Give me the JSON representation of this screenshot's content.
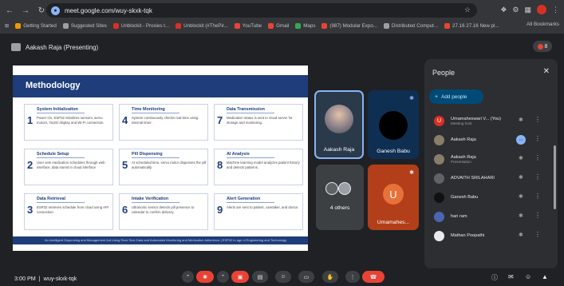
{
  "browser": {
    "url": "meet.google.com/wuy-skxk-tqk",
    "bookmarks": [
      {
        "label": "Getting Started",
        "color": "#f29900"
      },
      {
        "label": "Suggested Sites",
        "color": "#9aa0a6"
      },
      {
        "label": "Unblockit - Proxies t...",
        "color": "#d93025"
      },
      {
        "label": "Unblockit (#ThePir...",
        "color": "#d93025"
      },
      {
        "label": "YouTube",
        "color": "#ea4335"
      },
      {
        "label": "Gmail",
        "color": "#ea4335"
      },
      {
        "label": "Maps",
        "color": "#34a853"
      },
      {
        "label": "(987) Modular Expo...",
        "color": "#ea4335"
      },
      {
        "label": "Distributed Comput...",
        "color": "#9aa0a6"
      },
      {
        "label": "27.16 27.16 New pl...",
        "color": "#ea4335"
      }
    ],
    "all_bookmarks": "All Bookmarks"
  },
  "meet": {
    "presenter": "Aakash Raja (Presenting)",
    "clock": "3:00 PM",
    "meeting_code": "wuy-skxk-tqk",
    "badge_count": "8"
  },
  "slide": {
    "title": "Methodology",
    "footer": "An Intelligent Dispensing and Management Aid Using Real-Time Data and Automated Monitoring and Medication Adherence | ESP32 in age of Engineering and Technology",
    "cards": [
      {
        "num": "1",
        "title": "System Initialization",
        "text": "Power On, ESP32 initializes sensors, servo motors, OLED display and Wi-Fi connection."
      },
      {
        "num": "2",
        "title": "Schedule Setup",
        "text": "User sets medication schedules through web interface, data stored in cloud interface"
      },
      {
        "num": "3",
        "title": "Data Retrieval",
        "text": "ESP32 retrieves schedule from cloud using API connection"
      },
      {
        "num": "4",
        "title": "Time Monitoring",
        "text": "System continuously checks real-time using internal timer."
      },
      {
        "num": "5",
        "title": "Pill Dispensing",
        "text": "At scheduled time, servo motor dispenses the pill automatically."
      },
      {
        "num": "6",
        "title": "Intake Verification",
        "text": "Ultrasonic sensor detects pill presence to calendar to confirm delivery."
      },
      {
        "num": "7",
        "title": "Data Transmission",
        "text": "Medication status is sent to cloud server for storage and monitoring."
      },
      {
        "num": "8",
        "title": "AI Analysis",
        "text": "Machine learning model analyzes patient history and detects patterns."
      },
      {
        "num": "9",
        "title": "Alert Generation",
        "text": "Alerts are sent to patient, caretaker, and doctor."
      }
    ]
  },
  "tiles": {
    "aakash": "Aakash Raja",
    "ganesh": "Ganesh Babu",
    "others": "4 others",
    "umamaheswari": "Umamahes...",
    "u_initial": "U"
  },
  "panel": {
    "title": "People",
    "add_label": "Add people",
    "people": [
      {
        "name": "Umamaheswari V... (You)",
        "sub": "Meeting host",
        "color": "#d93025",
        "initial": "U"
      },
      {
        "name": "Aakash Raja",
        "sub": "",
        "color": "#8b7d6b",
        "initial": ""
      },
      {
        "name": "Aakash Raja",
        "sub": "Presentation",
        "color": "#8b7d6b",
        "initial": ""
      },
      {
        "name": "ADVAITH SRILAHARI",
        "sub": "",
        "color": "#5f6368",
        "initial": ""
      },
      {
        "name": "Ganesh Babu",
        "sub": "",
        "color": "#111111",
        "initial": ""
      },
      {
        "name": "hari ram",
        "sub": "",
        "color": "#4a66b0",
        "initial": ""
      },
      {
        "name": "Mathan Poopathi",
        "sub": "",
        "color": "#e8eaed",
        "initial": ""
      }
    ]
  }
}
